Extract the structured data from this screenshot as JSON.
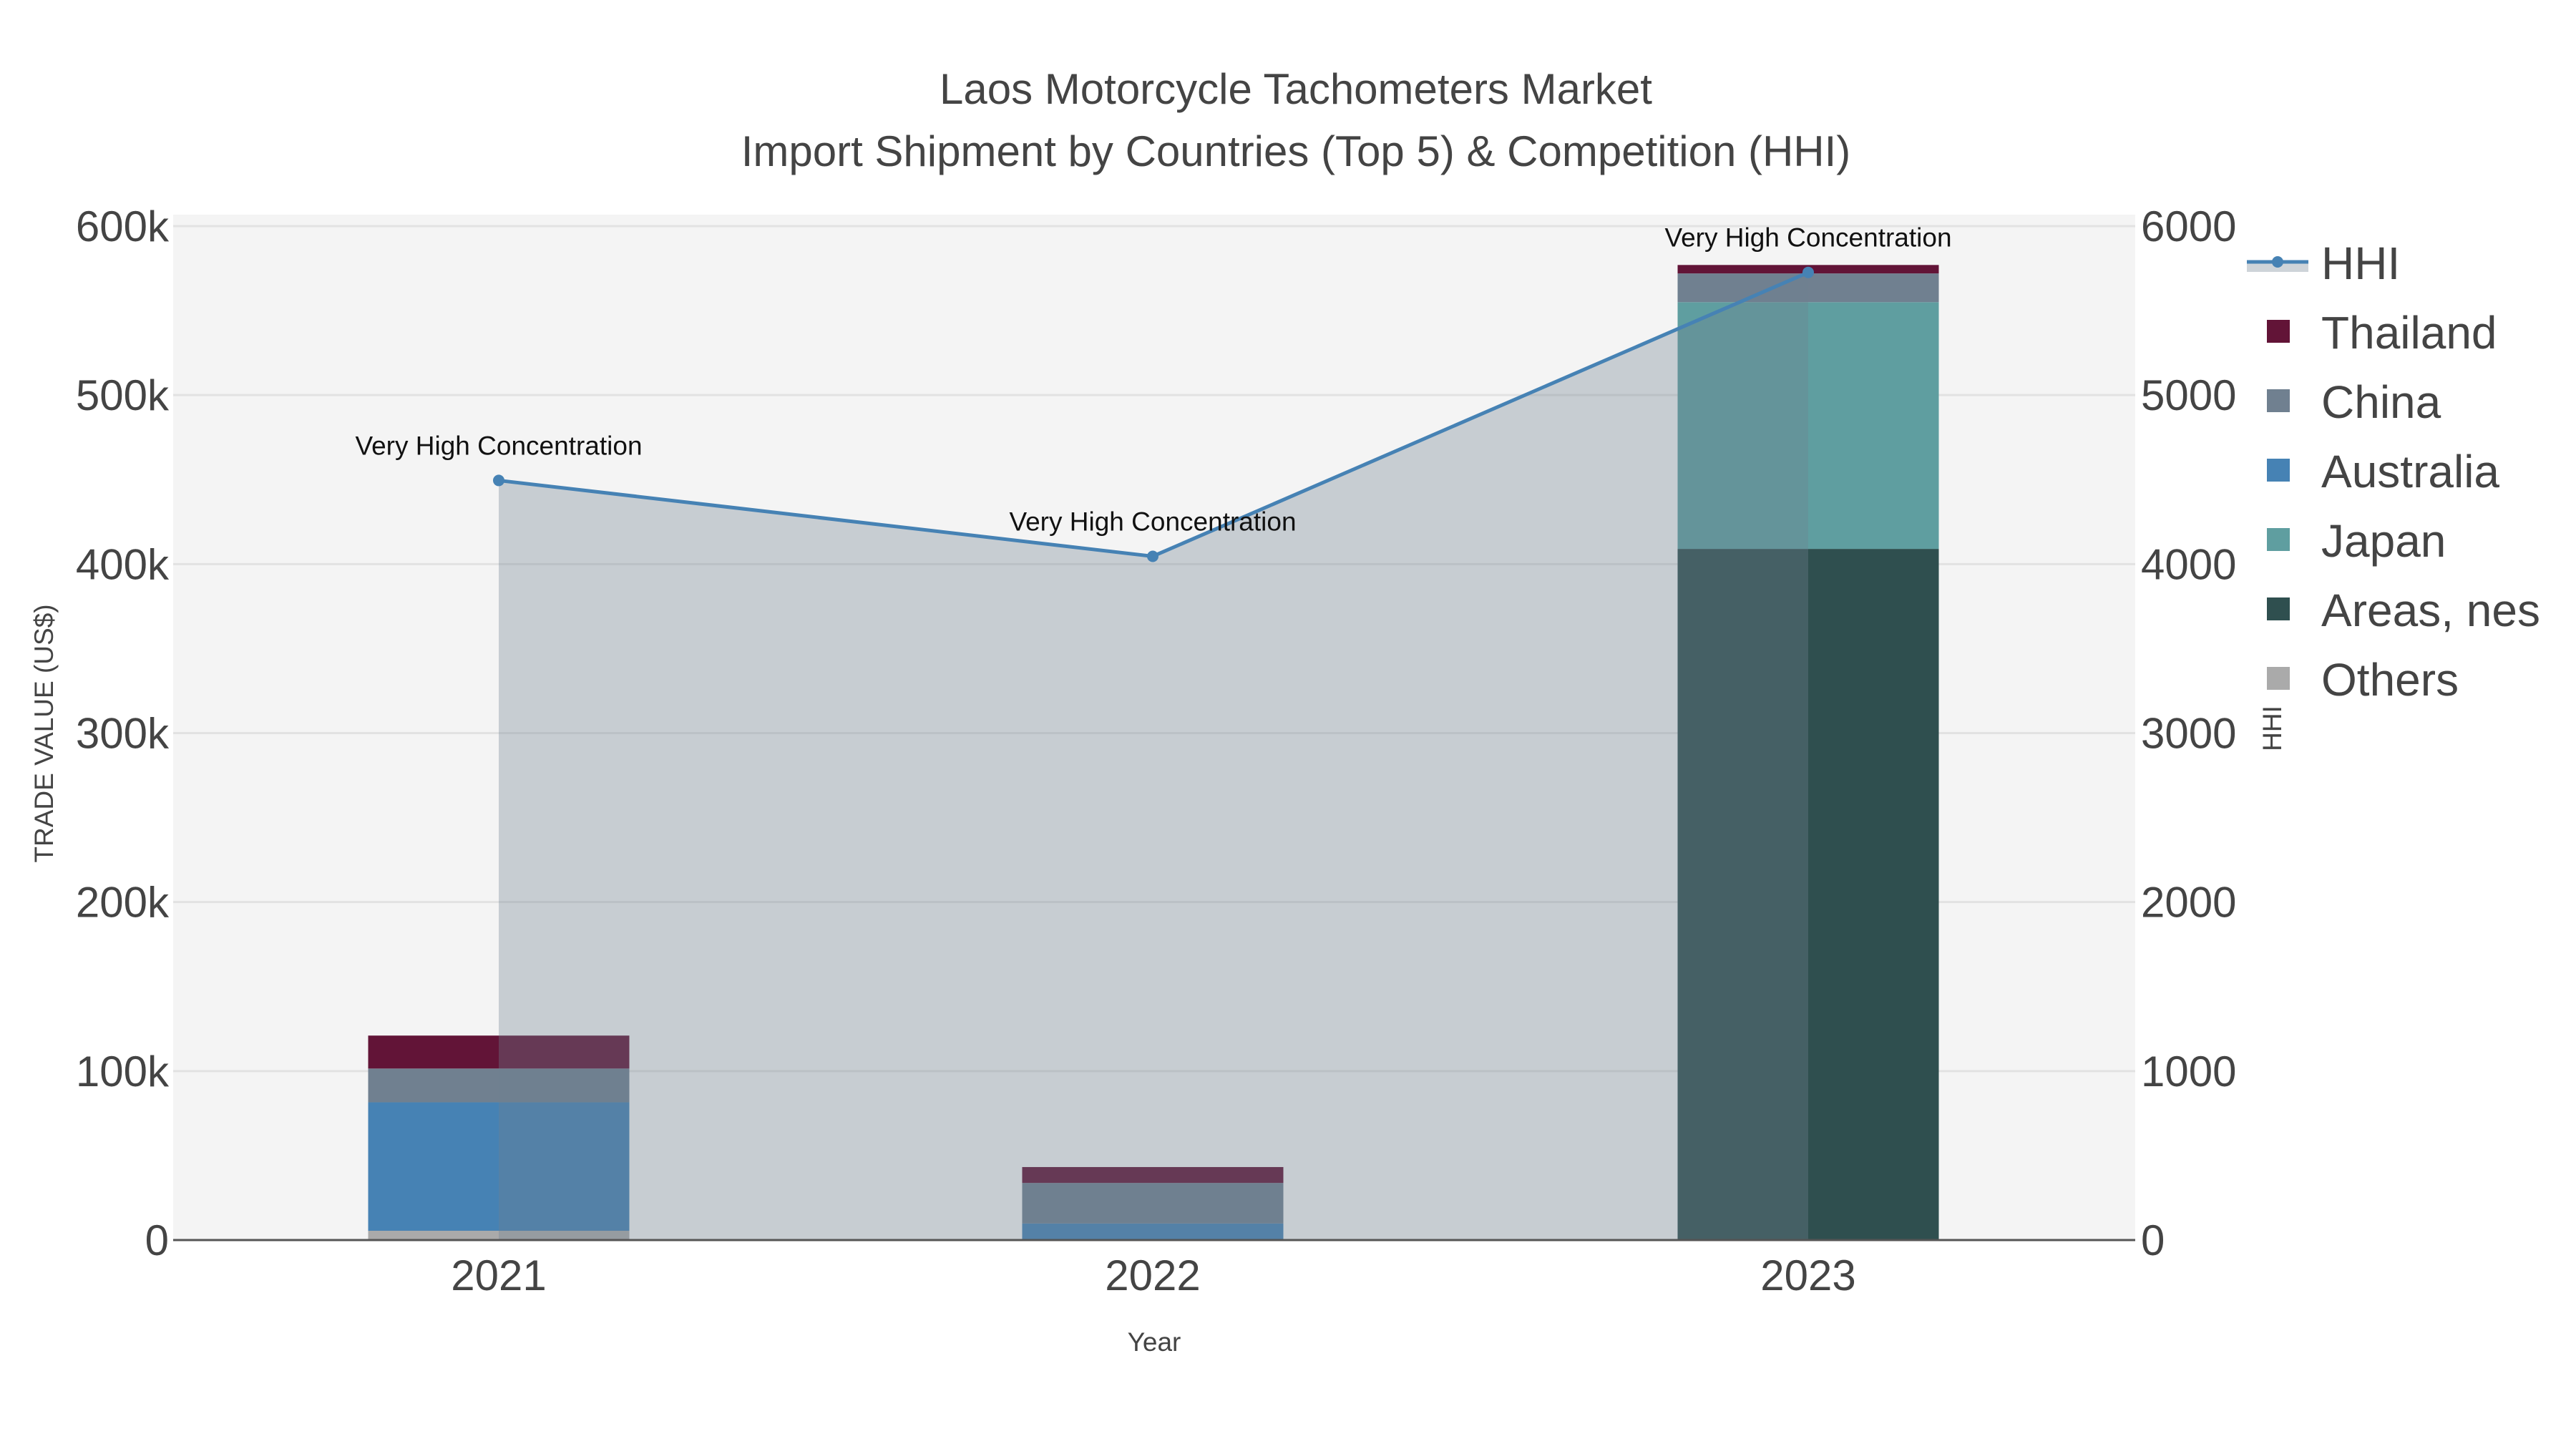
{
  "chart_data": {
    "type": "bar",
    "title": "Laos Motorcycle Tachometers Market",
    "subtitle": "Import Shipment by Countries (Top 5) & Competition (HHI)",
    "xlabel": "Year",
    "ylabel": "TRADE VALUE (US$)",
    "y2label": "HHI",
    "categories": [
      "2021",
      "2022",
      "2023"
    ],
    "ylim": [
      0,
      600000
    ],
    "y2lim": [
      0,
      6000
    ],
    "yticks": [
      0,
      100000,
      200000,
      300000,
      400000,
      500000,
      600000
    ],
    "ytick_labels": [
      "0",
      "100k",
      "200k",
      "300k",
      "400k",
      "500k",
      "600k"
    ],
    "y2ticks": [
      0,
      1000,
      2000,
      3000,
      4000,
      5000,
      6000
    ],
    "y2tick_labels": [
      "0",
      "1000",
      "2000",
      "3000",
      "4000",
      "5000",
      "6000"
    ],
    "grid": true,
    "legend_position": "right",
    "series": [
      {
        "name": "Others",
        "color": "#aaaaaa",
        "values": [
          5500,
          0,
          0
        ]
      },
      {
        "name": "Areas, nes",
        "color": "#2f4f4f",
        "values": [
          0,
          0,
          409000
        ]
      },
      {
        "name": "Japan",
        "color": "#5f9ea0",
        "values": [
          0,
          0,
          146000
        ]
      },
      {
        "name": "Australia",
        "color": "#4682b4",
        "values": [
          76000,
          9800,
          0
        ]
      },
      {
        "name": "China",
        "color": "#708090",
        "values": [
          20000,
          24000,
          17000
        ]
      },
      {
        "name": "Thailand",
        "color": "#621437",
        "values": [
          19500,
          9400,
          5000
        ]
      }
    ],
    "line": {
      "name": "HHI",
      "color": "#4682b4",
      "values": [
        4495,
        4046,
        5726
      ],
      "annotations": [
        "Very High Concentration",
        "Very High Concentration",
        "Very High Concentration"
      ]
    },
    "legend": [
      "HHI",
      "Thailand",
      "China",
      "Australia",
      "Japan",
      "Areas, nes",
      "Others"
    ]
  }
}
